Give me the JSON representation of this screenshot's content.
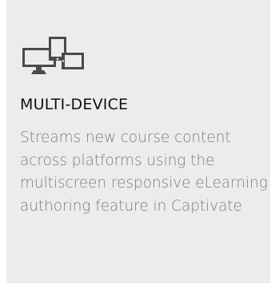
{
  "feature": {
    "icon": "multi-device-icon",
    "title": "MULTI-DEVICE",
    "description": "Streams new course content across platforms using the multiscreen responsive eLearning authoring feature in Captivate"
  },
  "colors": {
    "card_background": "#ececec",
    "icon": "#4a4a4a",
    "title": "#111111",
    "description": "#7d7d7d"
  }
}
